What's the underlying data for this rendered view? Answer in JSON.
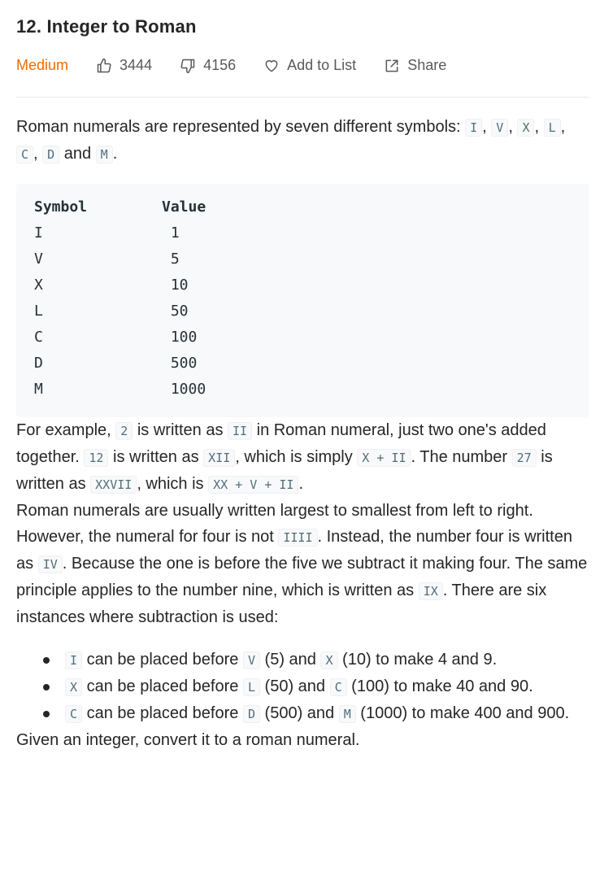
{
  "problem": {
    "title": "12. Integer to Roman",
    "difficulty": "Medium",
    "likes": "3444",
    "dislikes": "4156",
    "add_to_list_label": "Add to List",
    "share_label": "Share"
  },
  "colors": {
    "difficulty": "#ef6c00",
    "text": "#262626",
    "code_text": "#546e7a",
    "code_bg": "#f7f9fa"
  },
  "description": {
    "intro_text": "Roman numerals are represented by seven different symbols: ",
    "intro_symbols": [
      "I",
      "V",
      "X",
      "L",
      "C",
      "D",
      "M"
    ],
    "intro_and": " and ",
    "table": {
      "headers": [
        "Symbol",
        "Value"
      ],
      "rows": [
        [
          "I",
          "1"
        ],
        [
          "V",
          "5"
        ],
        [
          "X",
          "10"
        ],
        [
          "L",
          "50"
        ],
        [
          "C",
          "100"
        ],
        [
          "D",
          "500"
        ],
        [
          "M",
          "1000"
        ]
      ]
    },
    "example": {
      "t1": "For example, ",
      "c1": "2",
      "t2": " is written as ",
      "c2": "II",
      "t3": " in Roman numeral, just two one's added together. ",
      "c3": "12",
      "t4": " is written as ",
      "c4": "XII",
      "t5": ", which is simply ",
      "c5": "X + II",
      "t6": ". The number ",
      "c6": "27",
      "t7": " is written as ",
      "c7": "XXVII",
      "t8": ", which is ",
      "c8": "XX + V + II",
      "t9": "."
    },
    "ordering": {
      "t1": "Roman numerals are usually written largest to smallest from left to right. However, the numeral for four is not ",
      "c1": "IIII",
      "t2": ". Instead, the number four is written as ",
      "c2": "IV",
      "t3": ". Because the one is before the five we subtract it making four. The same principle applies to the number nine, which is written as ",
      "c3": "IX",
      "t4": ". There are six instances where subtraction is used:"
    },
    "rules": [
      {
        "a": "I",
        "t1": " can be placed before ",
        "b": "V",
        "t2": " (5) and ",
        "c": "X",
        "t3": " (10) to make 4 and 9."
      },
      {
        "a": "X",
        "t1": " can be placed before ",
        "b": "L",
        "t2": " (50) and ",
        "c": "C",
        "t3": " (100) to make 40 and 90."
      },
      {
        "a": "C",
        "t1": " can be placed before ",
        "b": "D",
        "t2": " (500) and ",
        "c": "M",
        "t3": " (1000) to make 400 and 900."
      }
    ],
    "final": "Given an integer, convert it to a roman numeral."
  }
}
